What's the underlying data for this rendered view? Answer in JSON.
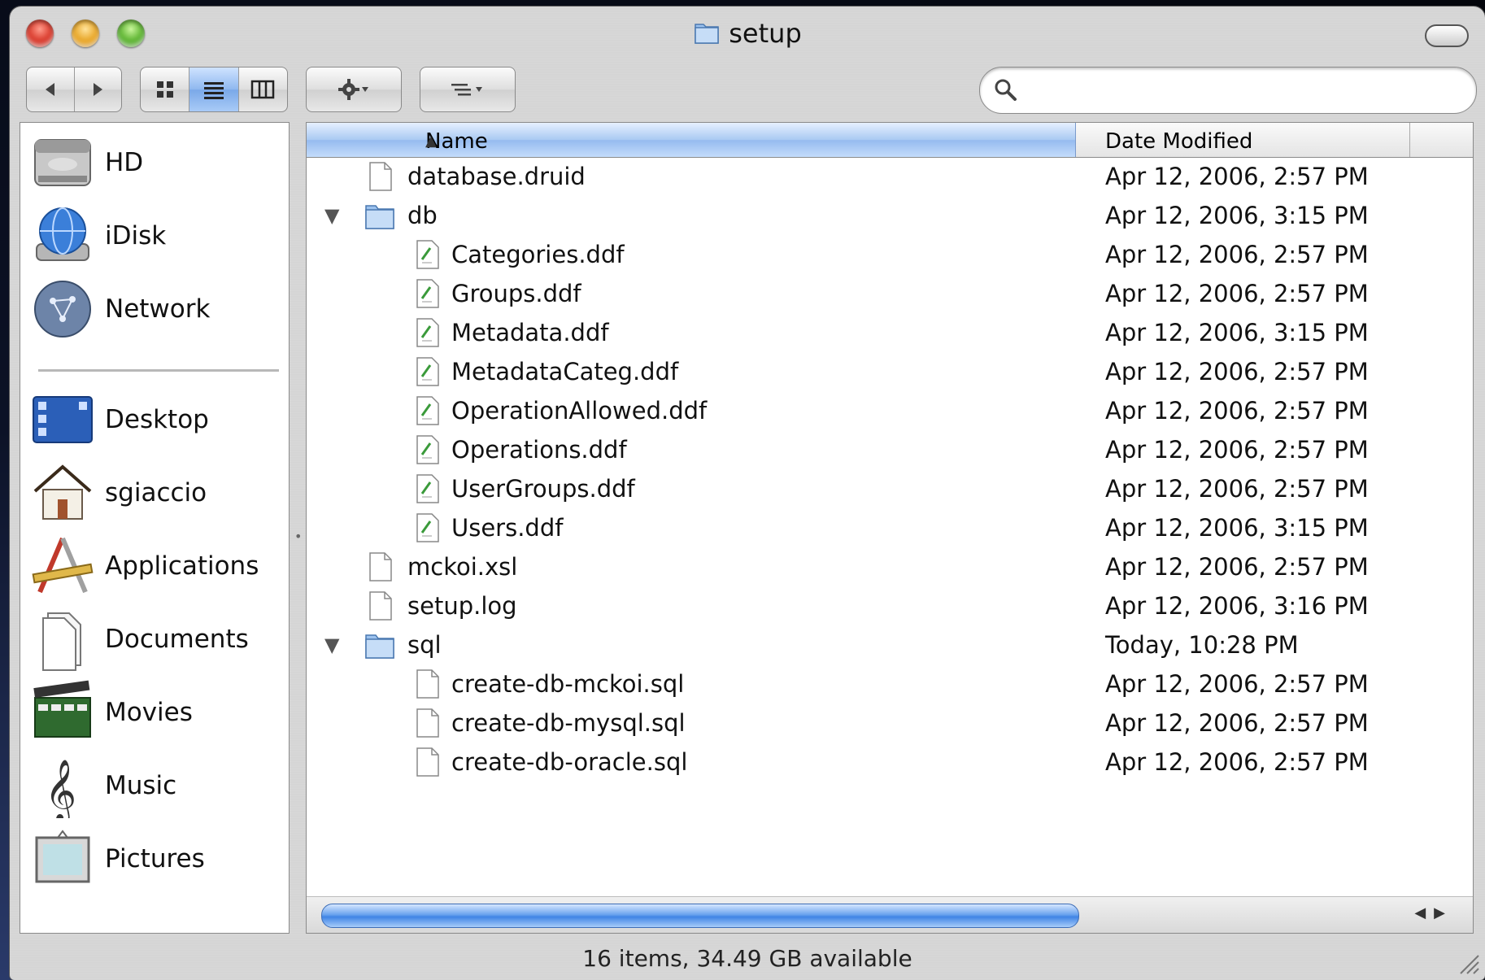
{
  "window": {
    "title": "setup"
  },
  "toolbar": {
    "back_icon": "back-arrow-icon",
    "forward_icon": "forward-arrow-icon",
    "view_modes": [
      "icon-view",
      "list-view",
      "column-view"
    ],
    "active_view": "list-view",
    "action_icon": "gear-icon",
    "arrange_icon": "arrange-icon",
    "search": {
      "placeholder": "",
      "value": ""
    }
  },
  "sidebar": {
    "devices": [
      {
        "label": "HD",
        "icon": "hard-drive-icon"
      },
      {
        "label": "iDisk",
        "icon": "idisk-icon"
      },
      {
        "label": "Network",
        "icon": "network-icon"
      }
    ],
    "places": [
      {
        "label": "Desktop",
        "icon": "desktop-icon"
      },
      {
        "label": "sgiaccio",
        "icon": "home-icon"
      },
      {
        "label": "Applications",
        "icon": "applications-icon"
      },
      {
        "label": "Documents",
        "icon": "documents-icon"
      },
      {
        "label": "Movies",
        "icon": "movies-icon"
      },
      {
        "label": "Music",
        "icon": "music-icon"
      },
      {
        "label": "Pictures",
        "icon": "pictures-icon"
      }
    ]
  },
  "list": {
    "columns": {
      "name": "Name",
      "date": "Date Modified"
    },
    "rows": [
      {
        "name": "database.druid",
        "date": "Apr 12, 2006, 2:57 PM",
        "kind": "document"
      },
      {
        "name": "db",
        "date": "Apr 12, 2006, 3:15 PM",
        "kind": "folder"
      },
      {
        "name": "Categories.ddf",
        "date": "Apr 12, 2006, 2:57 PM",
        "kind": "ddf"
      },
      {
        "name": "Groups.ddf",
        "date": "Apr 12, 2006, 2:57 PM",
        "kind": "ddf"
      },
      {
        "name": "Metadata.ddf",
        "date": "Apr 12, 2006, 3:15 PM",
        "kind": "ddf"
      },
      {
        "name": "MetadataCateg.ddf",
        "date": "Apr 12, 2006, 2:57 PM",
        "kind": "ddf"
      },
      {
        "name": "OperationAllowed.ddf",
        "date": "Apr 12, 2006, 2:57 PM",
        "kind": "ddf"
      },
      {
        "name": "Operations.ddf",
        "date": "Apr 12, 2006, 2:57 PM",
        "kind": "ddf"
      },
      {
        "name": "UserGroups.ddf",
        "date": "Apr 12, 2006, 2:57 PM",
        "kind": "ddf"
      },
      {
        "name": "Users.ddf",
        "date": "Apr 12, 2006, 3:15 PM",
        "kind": "ddf"
      },
      {
        "name": "mckoi.xsl",
        "date": "Apr 12, 2006, 2:57 PM",
        "kind": "document"
      },
      {
        "name": "setup.log",
        "date": "Apr 12, 2006, 3:16 PM",
        "kind": "document"
      },
      {
        "name": "sql",
        "date": "Today, 10:28 PM",
        "kind": "folder"
      },
      {
        "name": "create-db-mckoi.sql",
        "date": "Apr 12, 2006, 2:57 PM",
        "kind": "document"
      },
      {
        "name": "create-db-mysql.sql",
        "date": "Apr 12, 2006, 2:57 PM",
        "kind": "document"
      },
      {
        "name": "create-db-oracle.sql",
        "date": "Apr 12, 2006, 2:57 PM",
        "kind": "document"
      }
    ],
    "expanded_folders": [
      "db",
      "sql"
    ]
  },
  "status": {
    "text": "16 items, 34.49 GB available"
  }
}
